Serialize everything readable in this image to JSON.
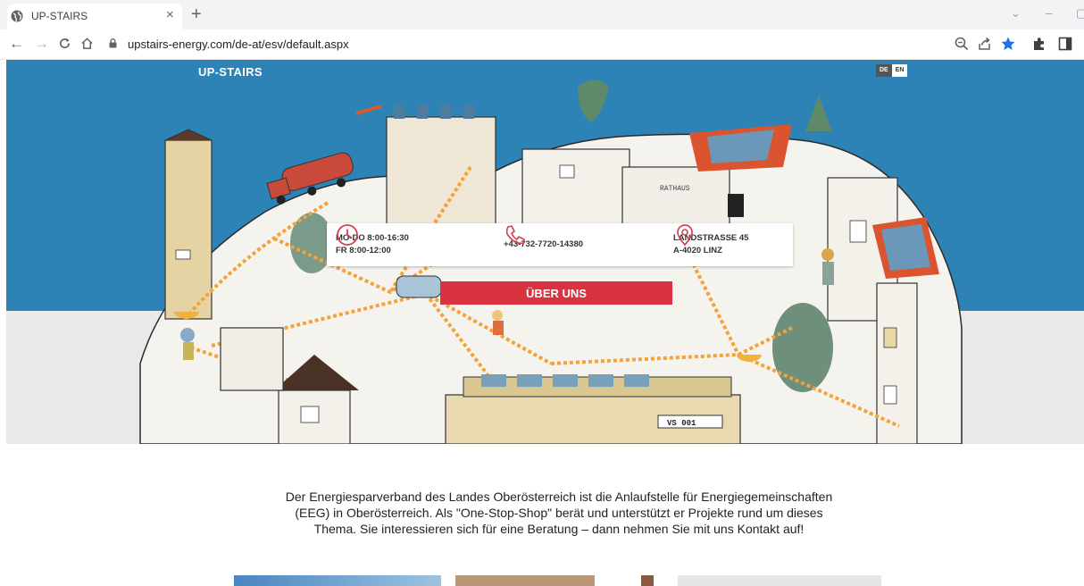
{
  "browser": {
    "tab_title": "UP-STAIRS",
    "url": "upstairs-energy.com/de-at/esv/default.aspx",
    "new_tab_symbol": "+",
    "tab_close_symbol": "×"
  },
  "nav": {
    "brand": "UP-STAIRS",
    "languages": [
      "DE",
      "EN"
    ],
    "active_language": "DE"
  },
  "contact": {
    "hours": [
      "MO-DO 8:00-16:30",
      "FR 8:00-12:00"
    ],
    "phone": "+43-732-7720-14380",
    "address": [
      "LANDSTRASSE 45",
      "A-4020 LINZ"
    ]
  },
  "hero": {
    "cta_label": "ÜBER UNS",
    "illustration_labels": {
      "rathaus": "RATHAUS",
      "school": "VS 001"
    }
  },
  "intro_text": "Der Energiesparverband des Landes Oberösterreich ist die Anlaufstelle für Energiegemeinschaften (EEG) in Oberösterreich. Als \"One-Stop-Shop\" berät und unterstützt er Projekte rund um dieses Thema. Sie interessieren sich für eine Beratung – dann nehmen Sie mit uns Kontakt auf!",
  "colors": {
    "sky": "#2d83b6",
    "accent": "#d9333f",
    "icon_red": "#d0424c",
    "ground": "#e9e9e9"
  },
  "icons": [
    "globe-icon",
    "lock-icon",
    "clock-icon",
    "phone-icon",
    "location-pin-icon",
    "zoom-icon",
    "share-icon",
    "star-icon",
    "extensions-icon",
    "sidepanel-icon"
  ]
}
